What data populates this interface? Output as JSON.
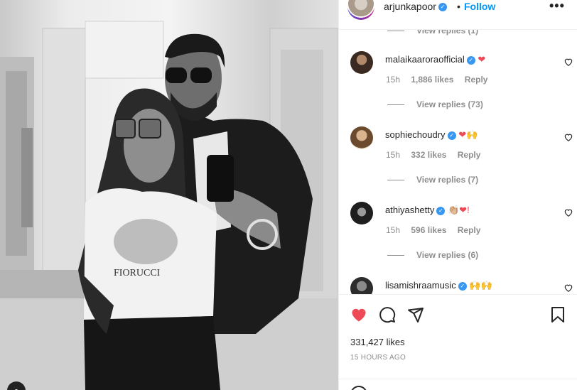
{
  "post": {
    "username": "arjunkapoor",
    "follow_label": "Follow",
    "dot": "•",
    "more_label": "•••",
    "likes_count": "331,427 likes",
    "timestamp": "15 HOURS AGO"
  },
  "top_replies": {
    "label": "View replies (1)"
  },
  "comments": [
    {
      "username": "malaikaaroraofficial",
      "emoji": "❤",
      "time": "15h",
      "likes": "1,886 likes",
      "reply": "Reply",
      "replies": "View replies (73)"
    },
    {
      "username": "sophiechoudry",
      "emoji": "❤🙌",
      "time": "15h",
      "likes": "332 likes",
      "reply": "Reply",
      "replies": "View replies (7)"
    },
    {
      "username": "athiyashetty",
      "emoji": "👏🏼❤!",
      "time": "15h",
      "likes": "596 likes",
      "reply": "Reply",
      "replies": "View replies (6)"
    },
    {
      "username": "lisamishraamusic",
      "emoji": "🙌🙌"
    }
  ],
  "colors": {
    "accent": "#0095f6",
    "like_red": "#ed4956",
    "verified": "#3897f0",
    "muted": "#8e8e8e"
  },
  "icons": [
    "heart-filled-icon",
    "comment-icon",
    "share-icon",
    "bookmark-icon",
    "more-icon",
    "verified-icon"
  ]
}
